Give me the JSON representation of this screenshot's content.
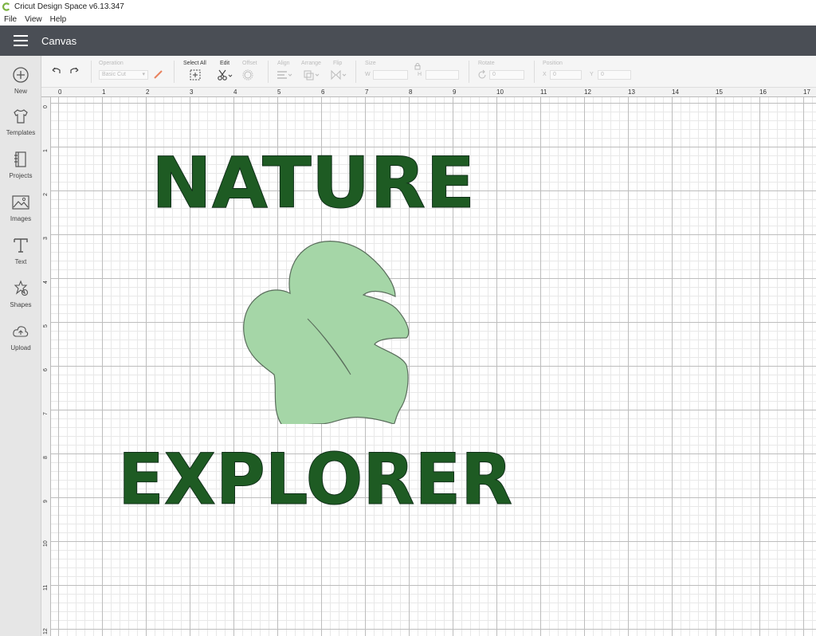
{
  "app": {
    "title": "Cricut Design Space  v6.13.347"
  },
  "menu": [
    "File",
    "View",
    "Help"
  ],
  "header": {
    "title": "Canvas"
  },
  "sidebar": {
    "items": [
      {
        "label": "New",
        "icon": "plus-circle-icon"
      },
      {
        "label": "Templates",
        "icon": "tshirt-icon"
      },
      {
        "label": "Projects",
        "icon": "notebook-icon"
      },
      {
        "label": "Images",
        "icon": "image-icon"
      },
      {
        "label": "Text",
        "icon": "text-icon"
      },
      {
        "label": "Shapes",
        "icon": "shapes-icon"
      },
      {
        "label": "Upload",
        "icon": "upload-cloud-icon"
      }
    ]
  },
  "toolbar": {
    "operation_label": "Operation",
    "operation_value": "Basic Cut",
    "select_all_label": "Select All",
    "edit_label": "Edit",
    "offset_label": "Offset",
    "align_label": "Align",
    "arrange_label": "Arrange",
    "flip_label": "Flip",
    "size_label": "Size",
    "size_w": "W",
    "size_h": "H",
    "rotate_label": "Rotate",
    "rotate_value": "0",
    "position_label": "Position",
    "position_x": "X",
    "position_y": "Y",
    "position_x_value": "0",
    "position_y_value": "0"
  },
  "rulers": {
    "top": [
      "0",
      "1",
      "2",
      "3",
      "4",
      "5",
      "6",
      "7",
      "8",
      "9",
      "10",
      "11",
      "12",
      "13",
      "14",
      "15",
      "16",
      "17"
    ],
    "left": [
      "0",
      "1",
      "2",
      "3",
      "4",
      "5",
      "6",
      "7",
      "8",
      "9",
      "10",
      "11",
      "12"
    ]
  },
  "canvas": {
    "text_top": "NATURE",
    "text_bottom": "EXPLORER",
    "text_color": "#1e5b23",
    "leaf_color": "#a5d6a7"
  }
}
